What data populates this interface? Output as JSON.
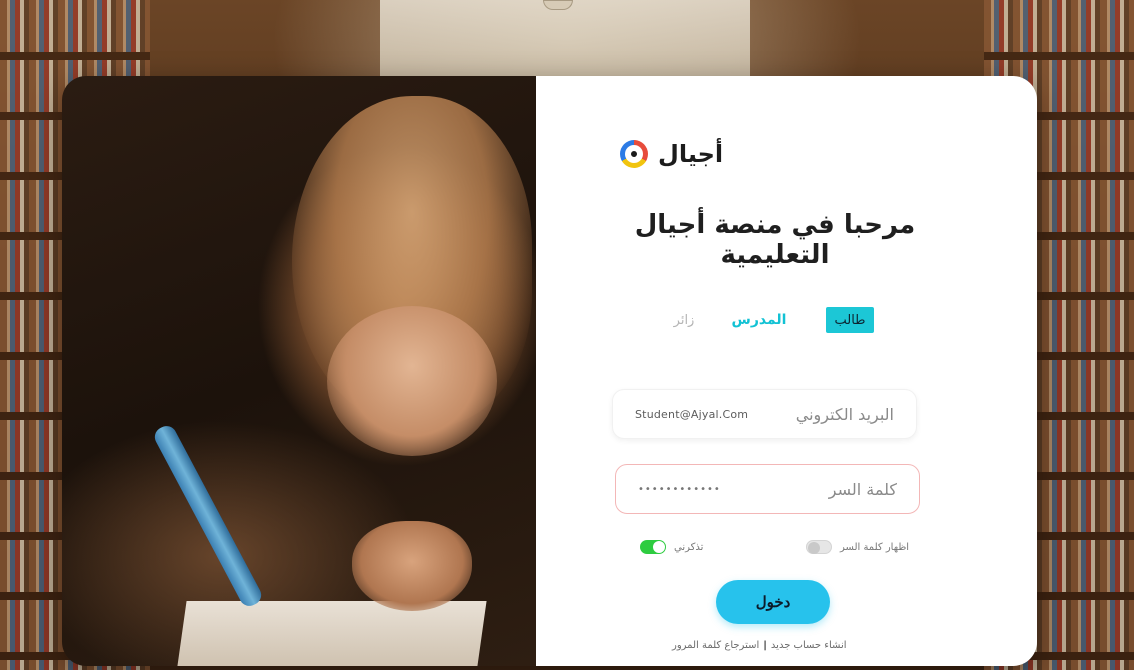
{
  "brand": {
    "name": "أجيال",
    "logo_icon": "ajyal-circle-logo"
  },
  "welcome_title": "مرحبا في منصة أجيال التعليمية",
  "roles": {
    "student": "طالب",
    "teacher": "المدرس",
    "visitor": "زائر",
    "selected": "student"
  },
  "email_field": {
    "label": "البريد الكتروني",
    "value": "Student@Ajyal.Com"
  },
  "password_field": {
    "label": "كلمة السر",
    "value": "••••••••••••"
  },
  "options": {
    "show_password_label": "اظهار كلمة السر",
    "show_password_on": false,
    "remember_me_label": "تذكرني",
    "remember_me_on": true
  },
  "login_button": "دخول",
  "footer": {
    "create_account": "انشاء حساب جديد",
    "separator": "|",
    "recover_password": "استرجاع كلمة المرور"
  },
  "colors": {
    "accent": "#1cc7d6",
    "button": "#27c2ec",
    "toggle_on": "#2ecc40",
    "password_border": "#f3b7b7"
  }
}
